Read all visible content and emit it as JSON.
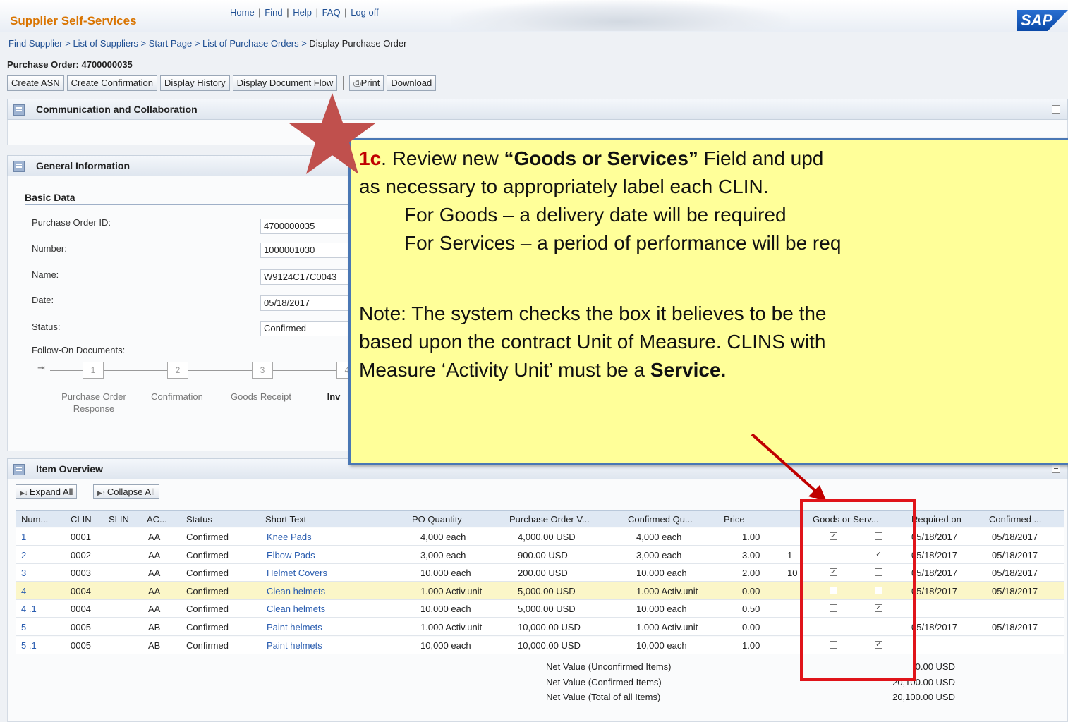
{
  "header": {
    "brand": "Supplier Self-Services",
    "links": [
      "Home",
      "Find",
      "Help",
      "FAQ",
      "Log off"
    ],
    "logo": "SAP"
  },
  "breadcrumb": [
    "Find Supplier",
    "List of Suppliers",
    "Start Page",
    "List of Purchase Orders",
    "Display Purchase Order"
  ],
  "po_title": "Purchase Order: 4700000035",
  "toolbar": {
    "create_asn": "Create ASN",
    "create_confirmation": "Create Confirmation",
    "display_history": "Display History",
    "display_document_flow": "Display Document Flow",
    "print": "Print",
    "download": "Download"
  },
  "panels": {
    "communication": "Communication and Collaboration",
    "general": "General Information",
    "item_overview": "Item Overview"
  },
  "basic_data": {
    "title": "Basic Data",
    "fields": [
      {
        "label": "Purchase Order ID:",
        "value": "4700000035"
      },
      {
        "label": "Number:",
        "value": "1000001030"
      },
      {
        "label": "Name:",
        "value": "W9124C17C0043"
      },
      {
        "label": "Date:",
        "value": "05/18/2017"
      },
      {
        "label": "Status:",
        "value": "Confirmed"
      }
    ],
    "follow_on_label": "Follow-On Documents:",
    "steps": [
      {
        "num": "1",
        "label": "Purchase Order Response"
      },
      {
        "num": "2",
        "label": "Confirmation"
      },
      {
        "num": "3",
        "label": "Goods Receipt"
      },
      {
        "num": "4",
        "label": "Inv"
      }
    ]
  },
  "item_overview": {
    "expand_all": "Expand All",
    "collapse_all": "Collapse All",
    "columns": [
      "Num...",
      "CLIN",
      "SLIN",
      "AC...",
      "Status",
      "Short Text",
      "PO Quantity",
      "Purchase Order V...",
      "Confirmed Qu...",
      "Price",
      "Goods or Serv...",
      "Required on",
      "Confirmed ..."
    ],
    "rows": [
      {
        "num": "1",
        "clin": "0001",
        "ac": "AA",
        "status": "Confirmed",
        "text": "Knee Pads",
        "qty": "4,000 each",
        "value": "4,000.00 USD",
        "conf_qty": "4,000 each",
        "price": "1.00",
        "extra": "",
        "goods": true,
        "services": false,
        "required": "05/18/2017",
        "confirmed": "05/18/2017"
      },
      {
        "num": "2",
        "clin": "0002",
        "ac": "AA",
        "status": "Confirmed",
        "text": "Elbow Pads",
        "qty": "3,000 each",
        "value": "900.00 USD",
        "conf_qty": "3,000 each",
        "price": "3.00",
        "extra": "1",
        "goods": false,
        "services": true,
        "required": "05/18/2017",
        "confirmed": "05/18/2017"
      },
      {
        "num": "3",
        "clin": "0003",
        "ac": "AA",
        "status": "Confirmed",
        "text": "Helmet Covers",
        "qty": "10,000 each",
        "value": "200.00 USD",
        "conf_qty": "10,000 each",
        "price": "2.00",
        "extra": "10",
        "goods": true,
        "services": false,
        "required": "05/18/2017",
        "confirmed": "05/18/2017"
      },
      {
        "num": "4",
        "clin": "0004",
        "ac": "AA",
        "status": "Confirmed",
        "text": "Clean helmets",
        "qty": "1.000 Activ.unit",
        "value": "5,000.00 USD",
        "conf_qty": "1.000 Activ.unit",
        "price": "0.00",
        "extra": "",
        "goods": false,
        "services": false,
        "required": "05/18/2017",
        "confirmed": "05/18/2017"
      },
      {
        "num": "4 .1",
        "clin": "0004",
        "ac": "AA",
        "status": "Confirmed",
        "text": "Clean helmets",
        "qty": "10,000 each",
        "value": "5,000.00 USD",
        "conf_qty": "10,000 each",
        "price": "0.50",
        "extra": "",
        "goods": false,
        "services": true,
        "required": "",
        "confirmed": ""
      },
      {
        "num": "5",
        "clin": "0005",
        "ac": "AB",
        "status": "Confirmed",
        "text": "Paint helmets",
        "qty": "1.000 Activ.unit",
        "value": "10,000.00 USD",
        "conf_qty": "1.000 Activ.unit",
        "price": "0.00",
        "extra": "",
        "goods": false,
        "services": false,
        "required": "05/18/2017",
        "confirmed": "05/18/2017"
      },
      {
        "num": "5 .1",
        "clin": "0005",
        "ac": "AB",
        "status": "Confirmed",
        "text": "Paint helmets",
        "qty": "10,000 each",
        "value": "10,000.00 USD",
        "conf_qty": "10,000 each",
        "price": "1.00",
        "extra": "",
        "goods": false,
        "services": true,
        "required": "",
        "confirmed": ""
      }
    ],
    "totals": [
      {
        "label": "Net Value (Unconfirmed Items)",
        "value": "0.00 USD"
      },
      {
        "label": "Net Value (Confirmed Items)",
        "value": "20,100.00 USD"
      },
      {
        "label": "Net Value (Total of all Items)",
        "value": "20,100.00 USD"
      }
    ]
  },
  "callout": {
    "step": "1c",
    "l1_pre": ". Review new ",
    "l1_bold": "“Goods or Services”",
    "l1_post": " Field and upd",
    "l2": "as necessary to appropriately label each CLIN.",
    "l3": "For Goods – a delivery date will be required",
    "l4": "For Services – a period of performance will be req",
    "l5": "Note: The system checks the box it believes to be the",
    "l6": "based upon the contract Unit of Measure.  CLINS with",
    "l7_pre": "Measure ‘Activity Unit’ must be a ",
    "l7_bold": "Service."
  },
  "colors": {
    "brand": "#d97400",
    "link": "#2a5db0",
    "callout_bg": "#ffff99",
    "highlight": "#e0141a"
  }
}
